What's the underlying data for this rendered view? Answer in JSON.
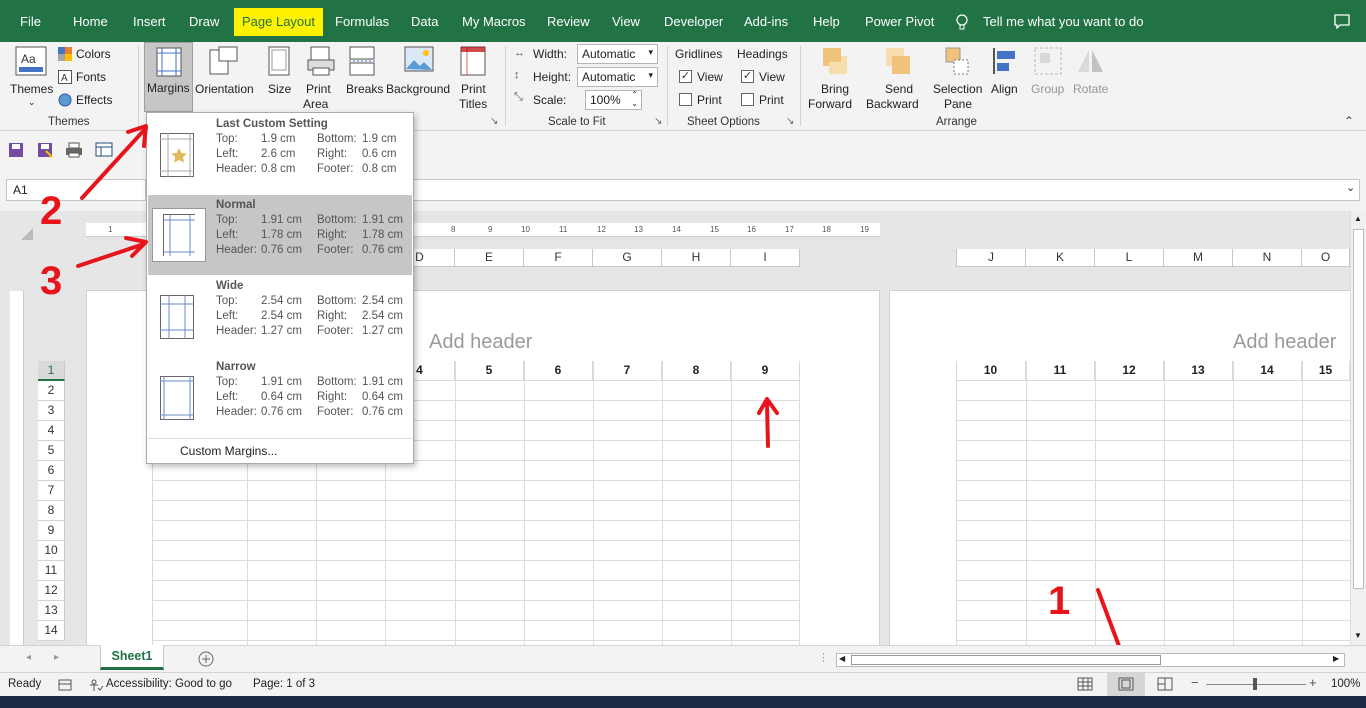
{
  "ribbon_tabs": [
    "File",
    "Home",
    "Insert",
    "Draw",
    "Page Layout",
    "Formulas",
    "Data",
    "My Macros",
    "Review",
    "View",
    "Developer",
    "Add-ins",
    "Help",
    "Power Pivot"
  ],
  "active_tab": "Page Layout",
  "tell_me": "Tell me what you want to do",
  "themes_group": {
    "themes": "Themes",
    "colors": "Colors",
    "fonts": "Fonts",
    "effects": "Effects",
    "label": "Themes"
  },
  "page_setup": {
    "margins": "Margins",
    "orientation": "Orientation",
    "size": "Size",
    "print_area_1": "Print",
    "print_area_2": "Area",
    "breaks": "Breaks",
    "background": "Background",
    "print_titles_1": "Print",
    "print_titles_2": "Titles"
  },
  "scale_to_fit": {
    "width_label": "Width:",
    "width_value": "Automatic",
    "height_label": "Height:",
    "height_value": "Automatic",
    "scale_label": "Scale:",
    "scale_value": "100%",
    "label": "Scale to Fit"
  },
  "sheet_options": {
    "gridlines": "Gridlines",
    "headings": "Headings",
    "view": "View",
    "print": "Print",
    "gridlines_view_checked": true,
    "gridlines_print_checked": false,
    "headings_view_checked": true,
    "headings_print_checked": false,
    "label": "Sheet Options"
  },
  "arrange": {
    "bring_1": "Bring",
    "bring_2": "Forward",
    "send_1": "Send",
    "send_2": "Backward",
    "selection_1": "Selection",
    "selection_2": "Pane",
    "align": "Align",
    "group": "Group",
    "rotate": "Rotate",
    "label": "Arrange"
  },
  "name_box": "A1",
  "margins_menu": {
    "options": [
      {
        "title": "Last Custom Setting",
        "top": "1.9 cm",
        "bottom": "1.9 cm",
        "left": "2.6 cm",
        "right": "0.6 cm",
        "header": "0.8 cm",
        "footer": "0.8 cm",
        "selected": false
      },
      {
        "title": "Normal",
        "top": "1.91 cm",
        "bottom": "1.91 cm",
        "left": "1.78 cm",
        "right": "1.78 cm",
        "header": "0.76 cm",
        "footer": "0.76 cm",
        "selected": true
      },
      {
        "title": "Wide",
        "top": "2.54 cm",
        "bottom": "2.54 cm",
        "left": "2.54 cm",
        "right": "2.54 cm",
        "header": "1.27 cm",
        "footer": "1.27 cm",
        "selected": false
      },
      {
        "title": "Narrow",
        "top": "1.91 cm",
        "bottom": "1.91 cm",
        "left": "0.64 cm",
        "right": "0.64 cm",
        "header": "0.76 cm",
        "footer": "0.76 cm",
        "selected": false
      }
    ],
    "labels": {
      "top": "Top:",
      "bottom": "Bottom:",
      "left": "Left:",
      "right": "Right:",
      "header": "Header:",
      "footer": "Footer:"
    },
    "custom": "Custom Margins..."
  },
  "ruler_ticks": [
    "1",
    "8",
    "9",
    "10",
    "11",
    "12",
    "13",
    "14",
    "15",
    "16",
    "17",
    "18",
    "19"
  ],
  "columns_page1": [
    "D",
    "E",
    "F",
    "G",
    "H",
    "I"
  ],
  "columns_page2": [
    "J",
    "K",
    "L",
    "M",
    "N",
    "O"
  ],
  "row1_page1": [
    "4",
    "5",
    "6",
    "7",
    "8",
    "9"
  ],
  "row1_page2": [
    "10",
    "11",
    "12",
    "13",
    "14",
    "15"
  ],
  "row_numbers": [
    "1",
    "2",
    "3",
    "4",
    "5",
    "6",
    "7",
    "8",
    "9",
    "10",
    "11",
    "12",
    "13",
    "14"
  ],
  "add_header": "Add header",
  "sheet_tab": "Sheet1",
  "status": {
    "ready": "Ready",
    "accessibility": "Accessibility: Good to go",
    "page": "Page: 1 of 3",
    "zoom": "100%"
  },
  "annotations": [
    "1",
    "2",
    "3"
  ],
  "colors": {
    "excel_green": "#217346",
    "highlight": "#fff200",
    "annotation_red": "#e8141c"
  }
}
